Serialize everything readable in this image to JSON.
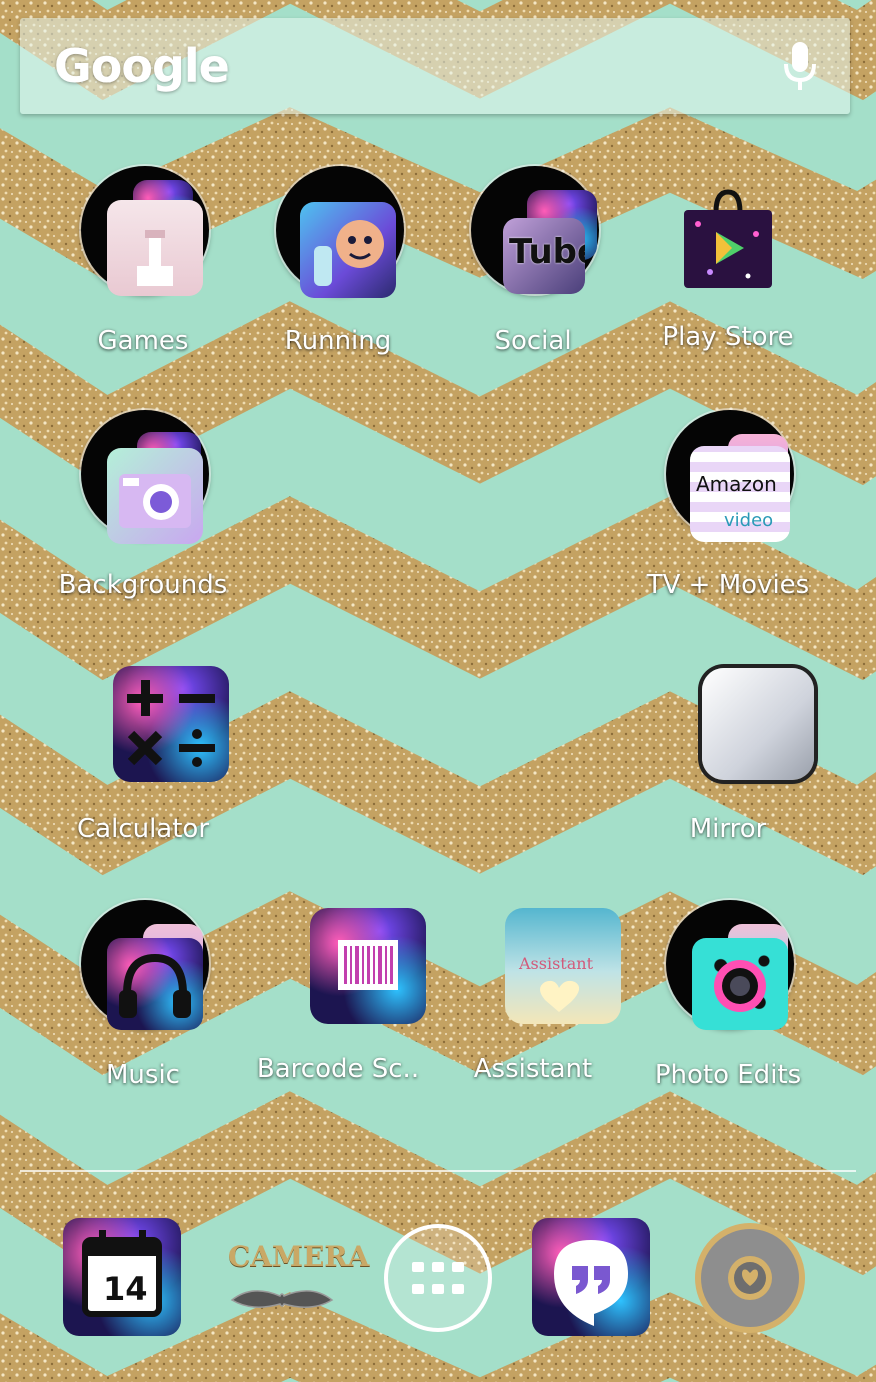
{
  "search": {
    "logo_text": "Google"
  },
  "apps": {
    "games": "Games",
    "running": "Running",
    "social": "Social",
    "play_store": "Play Store",
    "backgrounds": "Backgrounds",
    "tv_movies": "TV + Movies",
    "calculator": "Calculator",
    "mirror": "Mirror",
    "music": "Music",
    "barcode": "Barcode Sc..",
    "assistant": "Assistant",
    "photo_edits": "Photo Edits"
  },
  "icon_text": {
    "youtube": "Tube",
    "amazon": "Amazon",
    "video": "video",
    "assistant": "Assistant",
    "calendar_day": "14",
    "camera": "CAMERA"
  },
  "colors": {
    "wallpaper_mint": "#a4dfc9",
    "glitter_gold": "#c9a866",
    "label_text": "#ffffff"
  }
}
